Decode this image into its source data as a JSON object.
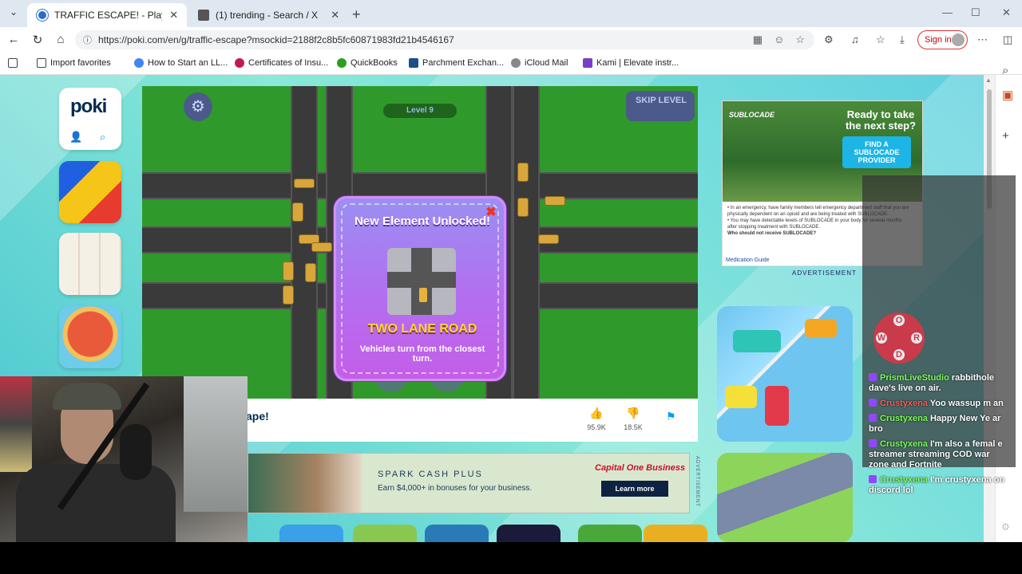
{
  "browser": {
    "tabs": [
      {
        "title": "TRAFFIC ESCAPE! - Play Online for",
        "active": true
      },
      {
        "title": "(1) trending - Search / X",
        "active": false
      }
    ],
    "url": "https://poki.com/en/g/traffic-escape?msockid=2188f2c8b5fc60871983fd21b4546167",
    "sign_in": "Sign in",
    "bookmarks": [
      {
        "label": "Import favorites",
        "icon": "import-icon"
      },
      {
        "label": "How to Start an LL...",
        "icon": "chrome-icon"
      },
      {
        "label": "Certificates of Insu...",
        "icon": "heart-icon"
      },
      {
        "label": "QuickBooks",
        "icon": "quickbooks-icon"
      },
      {
        "label": "Parchment Exchan...",
        "icon": "parchment-icon"
      },
      {
        "label": "iCloud Mail",
        "icon": "apple-icon"
      },
      {
        "label": "Kami | Elevate instr...",
        "icon": "kami-icon"
      }
    ]
  },
  "poki": {
    "logo": "poki"
  },
  "game": {
    "level": "Level 9",
    "skip_label": "SKIP LEVEL",
    "modal": {
      "title": "New Element Unlocked!",
      "element_name": "TWO LANE ROAD",
      "description": "Vehicles turn from the closest turn."
    },
    "title_fragment": "ape!",
    "likes": "95.9K",
    "dislikes": "18.5K"
  },
  "ads": {
    "bottom": {
      "headline": "SPARK CASH PLUS",
      "subline": "Earn $4,000+ in bonuses for your business.",
      "brand": "Capital One Business",
      "cta": "Learn more",
      "side_label": "ADVERTISEMENT"
    },
    "right": {
      "brand": "SUBLOCADE",
      "question": "Ready to take the next step?",
      "button": "FIND A SUBLOCADE PROVIDER",
      "body": [
        "• In an emergency, have family members tell emergency department staff that you are physically dependent on an opioid and are being treated with SUBLOCADE.",
        "• You may have detectable levels of SUBLOCADE in your body for several months after stopping treatment with SUBLOCADE.",
        "Who should not receive SUBLOCADE?"
      ],
      "med_guide": "Medication Guide",
      "label": "ADVERTISEMENT"
    }
  },
  "chat": {
    "messages": [
      {
        "user": "PrismLiveStudio",
        "text": "rabbithole dave's live on air.",
        "color": "#7cfc5a"
      },
      {
        "user": "Crustyxena",
        "text": "Yoo wassup m an",
        "color": "#ff5a5a"
      },
      {
        "user": "Crustyxena",
        "text": "Happy New Ye ar bro",
        "color": "#7cfc5a"
      },
      {
        "user": "Crustyxena",
        "text": "I'm also a femal e streamer streaming COD war zone and Fortnite",
        "color": "#7cfc5a"
      },
      {
        "user": "Crustyxena",
        "text": "I'm crustyxena on discord lol",
        "color": "#7cfc5a"
      }
    ],
    "logo_letters": [
      "O",
      "W",
      "R",
      "D"
    ]
  }
}
